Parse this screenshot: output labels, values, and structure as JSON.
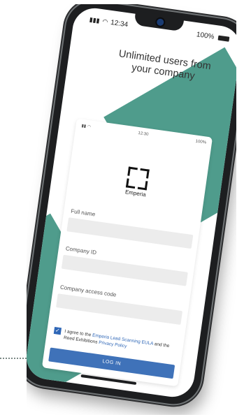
{
  "status_bar": {
    "time": "12:34",
    "battery": "100%"
  },
  "headline": "Unlimited users from your company",
  "inner_status": {
    "time": "12:30",
    "battery": "100%"
  },
  "brand": {
    "name": "Emperia"
  },
  "form": {
    "full_name_label": "Full name",
    "company_id_label": "Company ID",
    "access_code_label": "Company access code",
    "agree_text_prefix": "I agree to the",
    "eula_link": "Emperia Lead Scanning EULA",
    "agree_text_middle": "and the Reed Exhibitions",
    "privacy_link": "Privacy Policy",
    "login_label": "LOG IN"
  },
  "colors": {
    "accent": "#4f9c8c",
    "button": "#3f72b9",
    "link": "#2f67b7"
  }
}
